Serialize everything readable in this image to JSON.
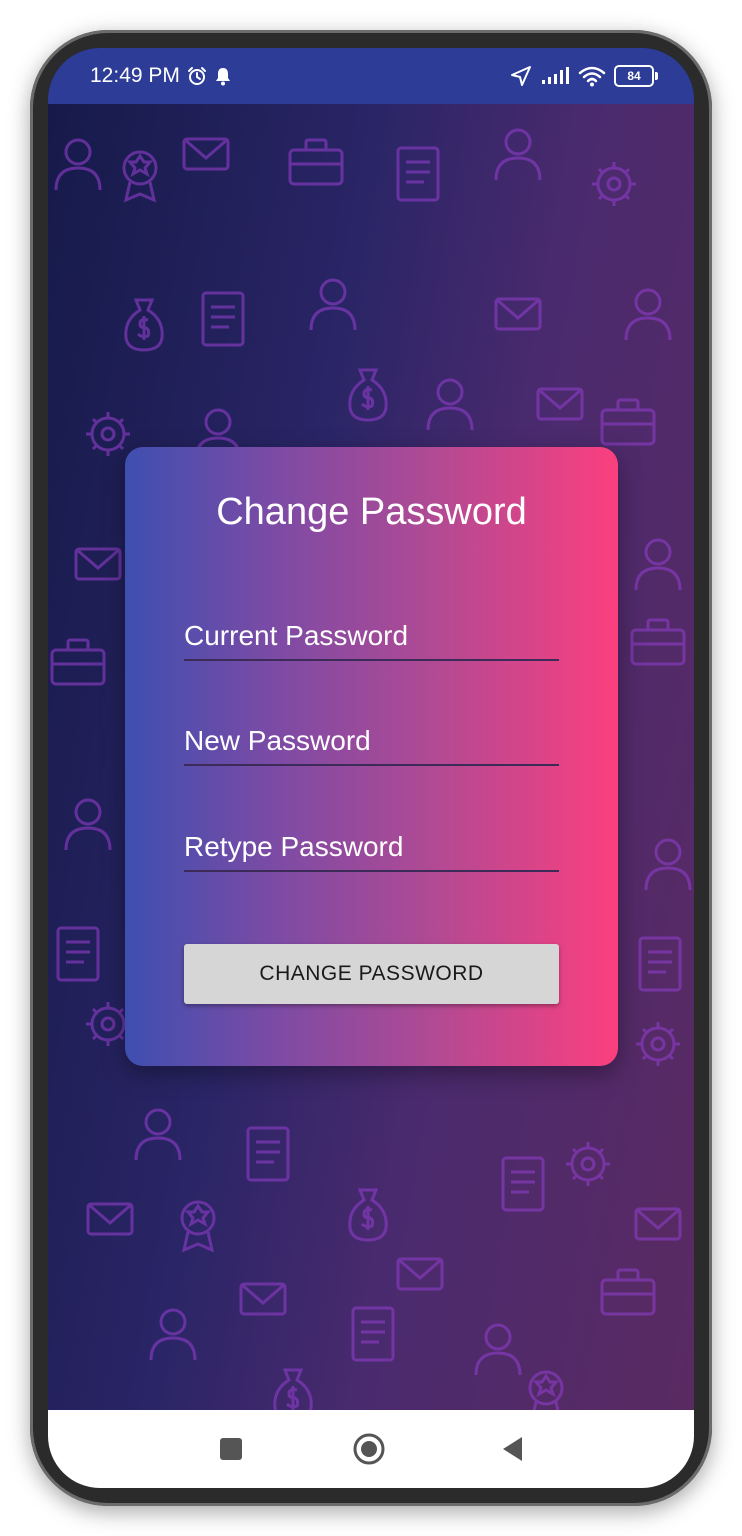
{
  "status_bar": {
    "time": "12:49 PM",
    "battery": "84"
  },
  "card": {
    "title": "Change Password",
    "fields": {
      "current_password_placeholder": "Current Password",
      "new_password_placeholder": "New Password",
      "retype_password_placeholder": "Retype Password"
    },
    "submit_label": "CHANGE PASSWORD"
  },
  "nav_bar": {
    "icons": [
      "recent-apps-icon",
      "home-icon",
      "back-icon"
    ]
  },
  "colors": {
    "status_bar": "#2c3c97",
    "card_gradient_start": "#3e4fb0",
    "card_gradient_end": "#fb3f7e",
    "button": "#d6d6d6"
  }
}
